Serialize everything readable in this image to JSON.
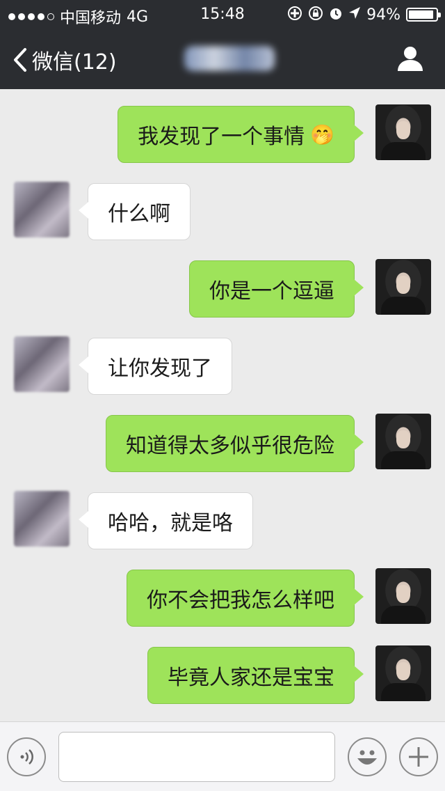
{
  "status_bar": {
    "carrier": "中国移动",
    "network": "4G",
    "time": "15:48",
    "battery": "94%",
    "battery_level": 0.94
  },
  "nav": {
    "back_label": "微信(12)"
  },
  "messages": [
    {
      "sender": "me",
      "text": "我发现了一个事情",
      "emoji": "🤭"
    },
    {
      "sender": "her",
      "text": "什么啊"
    },
    {
      "sender": "me",
      "text": "你是一个逗逼"
    },
    {
      "sender": "her",
      "text": "让你发现了"
    },
    {
      "sender": "me",
      "text": "知道得太多似乎很危险"
    },
    {
      "sender": "her",
      "text": "哈哈，就是咯"
    },
    {
      "sender": "me",
      "text": "你不会把我怎么样吧"
    },
    {
      "sender": "me",
      "text": "毕竟人家还是宝宝"
    }
  ],
  "colors": {
    "my_bubble": "#9ee35a",
    "her_bubble": "#ffffff",
    "nav_background": "#2b2d31",
    "chat_background": "#ebebeb"
  }
}
